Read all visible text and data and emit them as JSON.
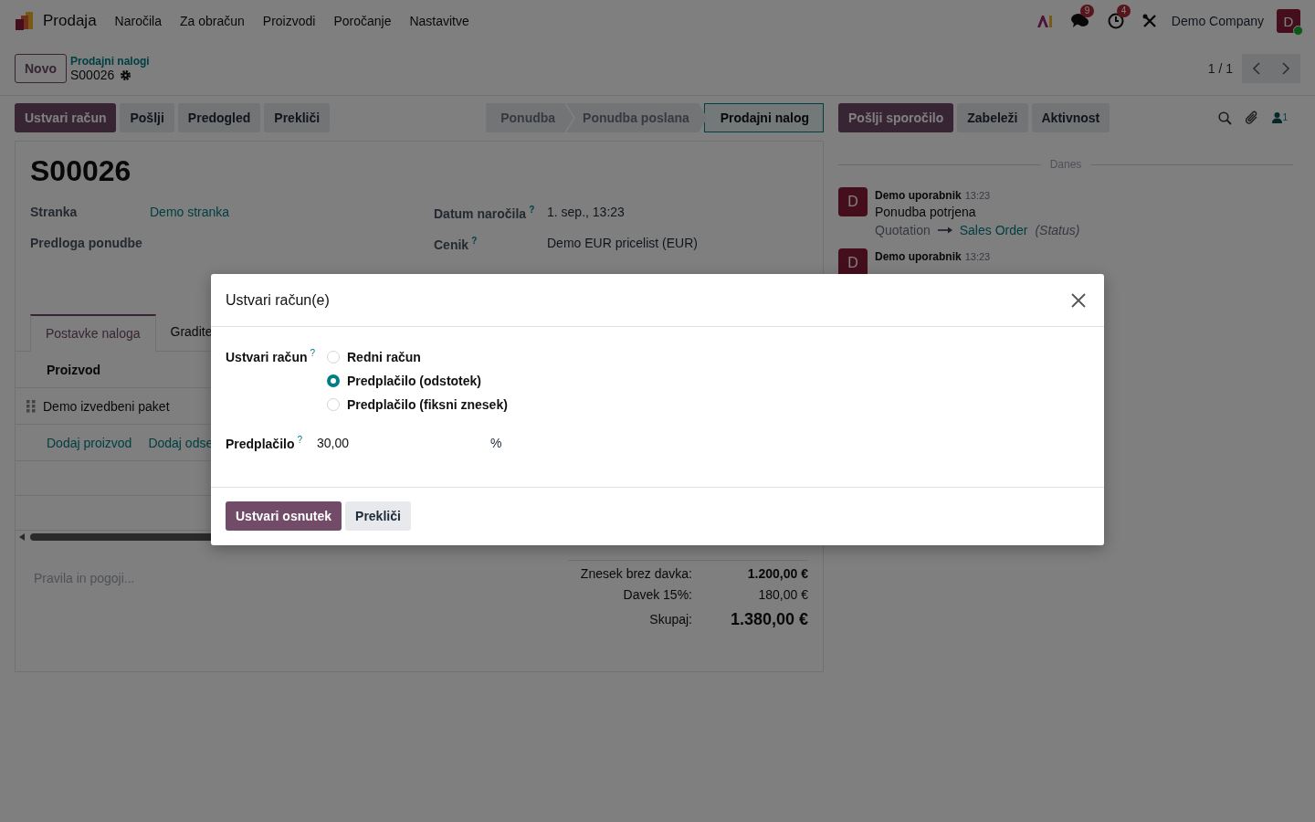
{
  "navbar": {
    "app_name": "Prodaja",
    "menu": [
      "Naročila",
      "Za obračun",
      "Proizvodi",
      "Poročanje",
      "Nastavitve"
    ],
    "messages_badge": "9",
    "activities_badge": "4",
    "company": "Demo Company",
    "avatar": "D"
  },
  "control_panel": {
    "new_button": "Novo",
    "breadcrumb": "Prodajni nalogi",
    "record": "S00026",
    "pager": "1 / 1"
  },
  "actions": [
    {
      "label": "Ustvari račun",
      "primary": true
    },
    {
      "label": "Pošlji",
      "primary": false
    },
    {
      "label": "Predogled",
      "primary": false
    },
    {
      "label": "Prekliči",
      "primary": false
    }
  ],
  "statusbar": [
    {
      "label": "Ponudba",
      "selected": false
    },
    {
      "label": "Ponudba poslana",
      "selected": false
    },
    {
      "label": "Prodajni nalog",
      "selected": true
    }
  ],
  "form": {
    "title": "S00026",
    "fields_left": [
      {
        "label": "Stranka",
        "value": "Demo stranka"
      },
      {
        "label": "Predloga ponudbe"
      }
    ],
    "fields_right": [
      {
        "label": "Datum naročila",
        "help": "?",
        "value": "1. sep., 13:23"
      },
      {
        "label": "Cenik",
        "help": "?",
        "value": "Demo EUR pricelist (EUR)"
      }
    ],
    "tabs": [
      {
        "label": "Postavke naloga",
        "selected": true
      },
      {
        "label": "Gradite",
        "selected": false
      }
    ],
    "column": "Proizvod",
    "rows": [
      "Demo izvedbeni paket"
    ],
    "add_links": [
      "Dodaj proizvod",
      "Dodaj odse"
    ],
    "terms_placeholder": "Pravila in pogoji...",
    "totals": [
      {
        "label": "Znesek brez davka:",
        "value": "1.200,00 €",
        "kind": "untaxed"
      },
      {
        "label": "Davek 15%:",
        "value": "180,00 €",
        "kind": "tax"
      },
      {
        "label": "Skupaj:",
        "value": "1.380,00 €",
        "kind": "total"
      }
    ]
  },
  "chatter": {
    "buttons": [
      {
        "label": "Pošlji sporočilo",
        "primary": true
      },
      {
        "label": "Zabeleži",
        "primary": false
      },
      {
        "label": "Aktivnost",
        "primary": false
      }
    ],
    "followers": "1",
    "date_separator": "Danes",
    "messages": [
      {
        "avatar": "D",
        "author": "Demo uporabnik",
        "time": "13:23",
        "body": "Ponudba potrjena",
        "tracking": {
          "old": "Quotation",
          "new": "Sales Order",
          "field": "(Status)"
        }
      },
      {
        "avatar": "D",
        "author": "Demo uporabnik",
        "time": "13:23"
      }
    ]
  },
  "dialog": {
    "title": "Ustvari račun(e)",
    "radio_label": "Ustvari račun",
    "radio_help": "?",
    "options": [
      {
        "label": "Redni račun",
        "selected": false
      },
      {
        "label": "Predplačilo (odstotek)",
        "selected": true
      },
      {
        "label": "Predplačilo (fiksni znesek)",
        "selected": false
      }
    ],
    "amount_label": "Predplačilo",
    "amount_help": "?",
    "amount_value": "30,00",
    "amount_unit": "%",
    "buttons": [
      {
        "label": "Ustvari osnutek",
        "primary": true
      },
      {
        "label": "Prekliči",
        "primary": false
      }
    ]
  }
}
